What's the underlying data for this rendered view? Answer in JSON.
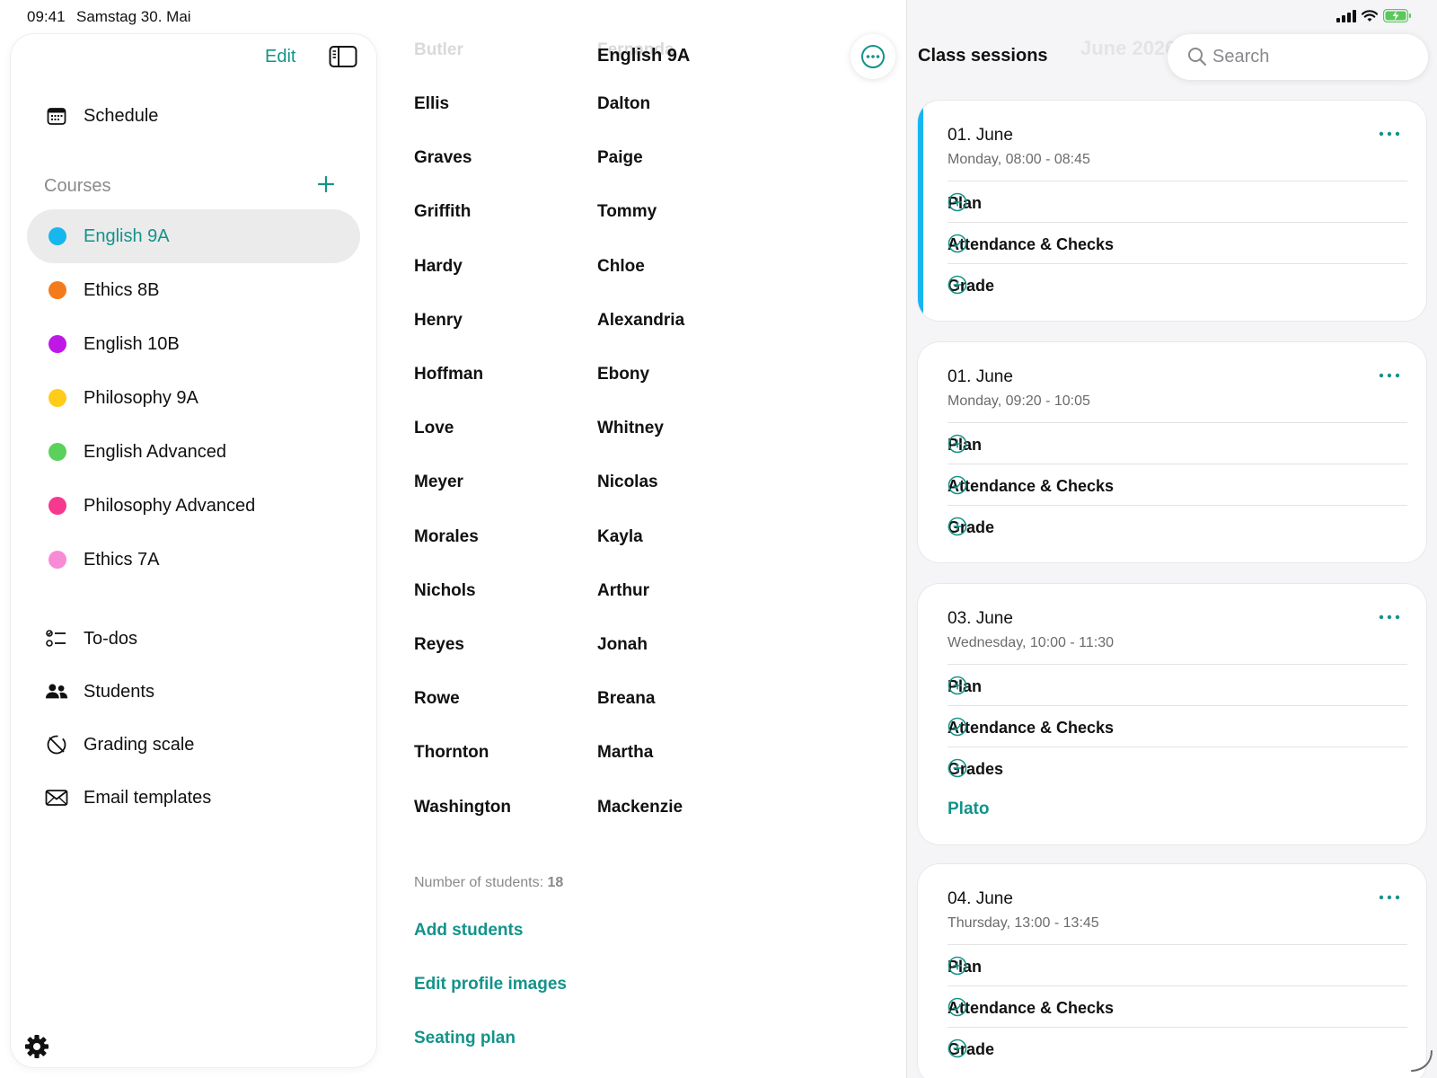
{
  "status": {
    "time": "09:41",
    "date": "Samstag 30. Mai"
  },
  "colors": {
    "accent": "#13938a",
    "session_highlight": "#16b6ee"
  },
  "sidebar": {
    "edit_label": "Edit",
    "schedule_label": "Schedule",
    "courses_header": "Courses",
    "courses": [
      {
        "label": "English 9A",
        "color": "#16b6ee",
        "selected": true
      },
      {
        "label": "Ethics 8B",
        "color": "#f47b1c",
        "selected": false
      },
      {
        "label": "English 10B",
        "color": "#bf18e6",
        "selected": false
      },
      {
        "label": "Philosophy 9A",
        "color": "#ffcc18",
        "selected": false
      },
      {
        "label": "English Advanced",
        "color": "#5ad15a",
        "selected": false
      },
      {
        "label": "Philosophy Advanced",
        "color": "#f5398e",
        "selected": false
      },
      {
        "label": "Ethics 7A",
        "color": "#f78bd6",
        "selected": false
      }
    ],
    "nav": [
      {
        "label": "To-dos",
        "icon": "checklist-icon"
      },
      {
        "label": "Students",
        "icon": "people-icon"
      },
      {
        "label": "Grading scale",
        "icon": "grading-scale-icon"
      },
      {
        "label": "Email templates",
        "icon": "envelope-icon"
      }
    ]
  },
  "middle": {
    "title": "English 9A",
    "faded_top_row": {
      "last": "Butler",
      "first": "Fernanda"
    },
    "students": [
      {
        "last": "Ellis",
        "first": "Dalton"
      },
      {
        "last": "Graves",
        "first": "Paige"
      },
      {
        "last": "Griffith",
        "first": "Tommy"
      },
      {
        "last": "Hardy",
        "first": "Chloe"
      },
      {
        "last": "Henry",
        "first": "Alexandria"
      },
      {
        "last": "Hoffman",
        "first": "Ebony"
      },
      {
        "last": "Love",
        "first": "Whitney"
      },
      {
        "last": "Meyer",
        "first": "Nicolas"
      },
      {
        "last": "Morales",
        "first": "Kayla"
      },
      {
        "last": "Nichols",
        "first": "Arthur"
      },
      {
        "last": "Reyes",
        "first": "Jonah"
      },
      {
        "last": "Rowe",
        "first": "Breana"
      },
      {
        "last": "Thornton",
        "first": "Martha"
      },
      {
        "last": "Washington",
        "first": "Mackenzie"
      }
    ],
    "count_label": "Number of students:",
    "count_value": "18",
    "links": [
      "Add students",
      "Edit profile images",
      "Seating plan"
    ]
  },
  "right": {
    "title": "Class sessions",
    "faded_title": "June 2026",
    "search_placeholder": "Search",
    "sessions": [
      {
        "date": "01. June",
        "time": "Monday, 08:00 - 08:45",
        "highlighted": true,
        "rows": [
          {
            "label": "Plan",
            "icon": "plus-circle-icon"
          },
          {
            "label": "Attendance & Checks",
            "icon": "check-circle-icon"
          },
          {
            "label": "Grade",
            "icon": "plus-circle-icon"
          }
        ],
        "link": ""
      },
      {
        "date": "01. June",
        "time": "Monday, 09:20 - 10:05",
        "highlighted": false,
        "rows": [
          {
            "label": "Plan",
            "icon": "plus-circle-icon"
          },
          {
            "label": "Attendance & Checks",
            "icon": "check-circle-icon"
          },
          {
            "label": "Grade",
            "icon": "plus-circle-icon"
          }
        ],
        "link": ""
      },
      {
        "date": "03. June",
        "time": "Wednesday, 10:00 - 11:30",
        "highlighted": false,
        "rows": [
          {
            "label": "Plan",
            "icon": "plus-circle-icon"
          },
          {
            "label": "Attendance & Checks",
            "icon": "check-circle-icon"
          },
          {
            "label": "Grades",
            "icon": "plus-circle-icon"
          }
        ],
        "link": "Plato"
      },
      {
        "date": "04. June",
        "time": "Thursday, 13:00 - 13:45",
        "highlighted": false,
        "rows": [
          {
            "label": "Plan",
            "icon": "plus-circle-icon"
          },
          {
            "label": "Attendance & Checks",
            "icon": "check-circle-icon"
          },
          {
            "label": "Grade",
            "icon": "plus-circle-icon"
          }
        ],
        "link": ""
      }
    ]
  }
}
